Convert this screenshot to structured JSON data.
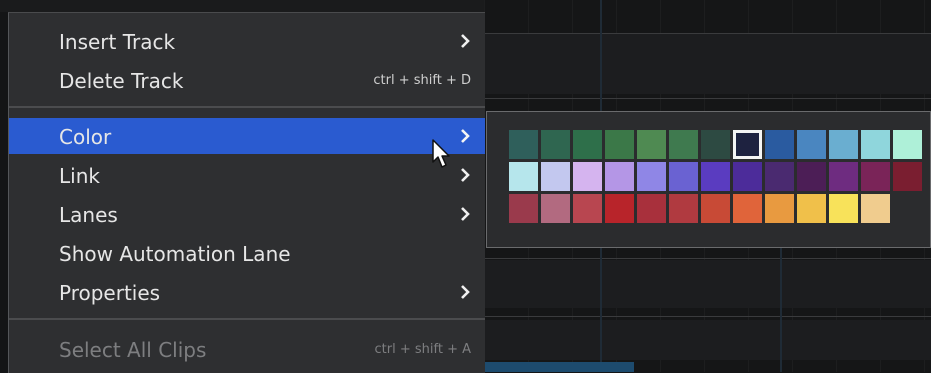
{
  "menu": {
    "items": [
      {
        "label": "Insert Track",
        "shortcut": "",
        "submenu": true,
        "state": "normal"
      },
      {
        "label": "Delete Track",
        "shortcut": "ctrl + shift + D",
        "submenu": false,
        "state": "normal"
      },
      {
        "label": "Color",
        "shortcut": "",
        "submenu": true,
        "state": "highlighted"
      },
      {
        "label": "Link",
        "shortcut": "",
        "submenu": true,
        "state": "normal"
      },
      {
        "label": "Lanes",
        "shortcut": "",
        "submenu": true,
        "state": "normal"
      },
      {
        "label": "Show Automation Lane",
        "shortcut": "",
        "submenu": false,
        "state": "normal"
      },
      {
        "label": "Properties",
        "shortcut": "",
        "submenu": true,
        "state": "normal"
      },
      {
        "label": "Select All Clips",
        "shortcut": "ctrl + shift + A",
        "submenu": false,
        "state": "disabled"
      }
    ]
  },
  "color_submenu": {
    "selected_index": 7,
    "rows": [
      [
        "#2f5f5b",
        "#2f6650",
        "#2e6f4a",
        "#3b7848",
        "#4f8a52",
        "#3f7a4f",
        "#2d4a42",
        "#1e2240",
        "#2a5ba0",
        "#4a86c0",
        "#6aaed0",
        "#8fd6dc",
        "#aef0d8"
      ],
      [
        "#b6e6ec",
        "#c3c8ef",
        "#d5b4ef",
        "#b496e6",
        "#8f86e6",
        "#6a62d2",
        "#5a3cc0",
        "#4c2c9a",
        "#4a2a70",
        "#4c1e56",
        "#6e2c80",
        "#7a2458",
        "#7a1e30"
      ],
      [
        "#9a3a4c",
        "#b26a80",
        "#b84650",
        "#b8242a",
        "#a8303c",
        "#b03a40",
        "#c84a36",
        "#e0643a",
        "#e89a40",
        "#f0c04a",
        "#f8e25a",
        "#f0cc8e"
      ]
    ]
  },
  "colors": {
    "menu_bg": "#2e2f31",
    "highlight": "#2a5bd0",
    "text": "#e6e6e6",
    "disabled_text": "#7d7e80"
  },
  "icons": {
    "submenu_arrow": "chevron-right-icon",
    "cursor": "mouse-pointer-icon"
  }
}
